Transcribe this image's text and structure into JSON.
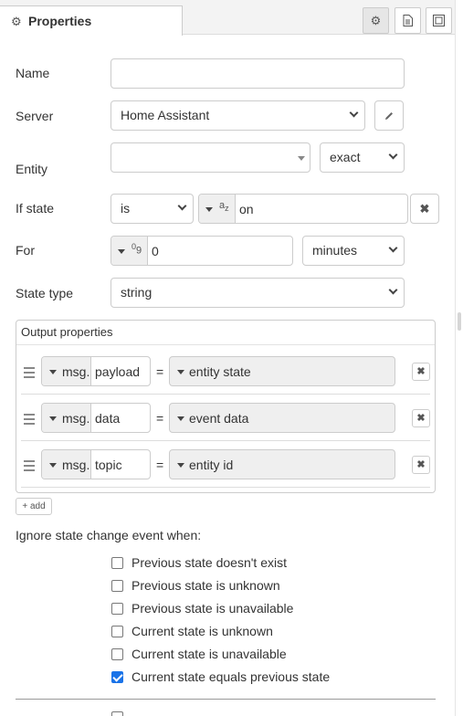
{
  "tabs": {
    "properties_label": "Properties",
    "icons": [
      "gear-icon",
      "document-icon",
      "frame-icon"
    ]
  },
  "form": {
    "name": {
      "label": "Name",
      "value": ""
    },
    "server": {
      "label": "Server",
      "value": "Home Assistant"
    },
    "entity": {
      "label": "Entity",
      "value": "",
      "match": "exact"
    },
    "if_state": {
      "label": "If state",
      "operator": "is",
      "type_icon": "a z",
      "value": "on"
    },
    "for": {
      "label": "For",
      "type_icon": "0 9",
      "value": "0",
      "unit": "minutes"
    },
    "state_type": {
      "label": "State type",
      "value": "string"
    }
  },
  "output": {
    "title": "Output properties",
    "rows": [
      {
        "prefix": "msg.",
        "property": "payload",
        "equals": "=",
        "value": "entity state"
      },
      {
        "prefix": "msg.",
        "property": "data",
        "equals": "=",
        "value": "event data"
      },
      {
        "prefix": "msg.",
        "property": "topic",
        "equals": "=",
        "value": "entity id"
      }
    ],
    "add_label": "+ add"
  },
  "ignore": {
    "heading": "Ignore state change event when:",
    "options": [
      {
        "label": "Previous state doesn't exist",
        "checked": false
      },
      {
        "label": "Previous state is unknown",
        "checked": false
      },
      {
        "label": "Previous state is unavailable",
        "checked": false
      },
      {
        "label": "Current state is unknown",
        "checked": false
      },
      {
        "label": "Current state is unavailable",
        "checked": false
      },
      {
        "label": "Current state equals previous state",
        "checked": true
      }
    ]
  },
  "colors": {
    "accent": "#1a73e8",
    "border": "#cccccc",
    "field_bg": "#efefef"
  }
}
